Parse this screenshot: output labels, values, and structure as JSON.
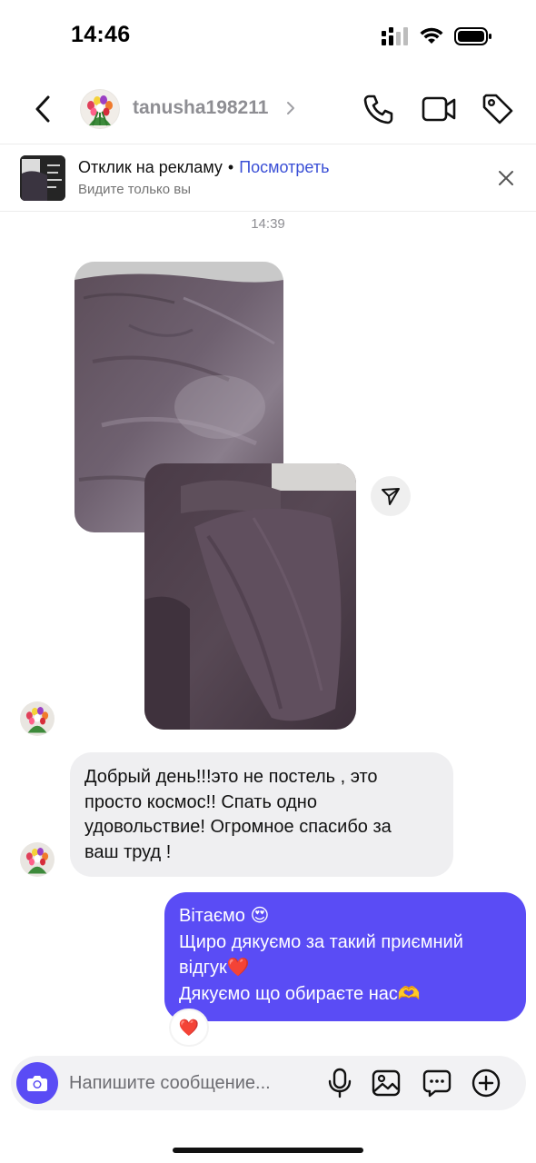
{
  "status_bar": {
    "time": "14:46",
    "signal_icon": "cellular-signal-icon",
    "wifi_icon": "wifi-icon",
    "battery_icon": "battery-icon"
  },
  "header": {
    "username": "tanusha198211",
    "back_icon": "chevron-left-icon",
    "call_icon": "phone-icon",
    "video_icon": "video-camera-icon",
    "tag_icon": "tag-icon"
  },
  "ad_banner": {
    "title": "Отклик на рекламу",
    "separator": "•",
    "link": "Посмотреть",
    "subtitle": "Видите только вы",
    "close_icon": "close-icon"
  },
  "conversation": {
    "timestamp": "14:39",
    "incoming_text_lines": [
      "Добрый день!!!это не постель , это",
      "просто космос!! Спать одно",
      "удовольствие! Огромное спасибо за",
      "ваш труд !"
    ],
    "outgoing_text_lines": [
      "Вітаємо 😍",
      "Щиро дякуємо за такий приємний",
      "відгук❤️",
      "Дякуємо що обираєте нас🫶"
    ],
    "reaction": "❤️",
    "share_icon": "send-icon"
  },
  "composer": {
    "placeholder": "Напишите сообщение...",
    "camera_icon": "camera-icon",
    "mic_icon": "microphone-icon",
    "gallery_icon": "image-icon",
    "sticker_icon": "chat-bubble-icon",
    "add_icon": "plus-circle-icon"
  },
  "colors": {
    "accent": "#5a4cf5",
    "link": "#3a4fd6",
    "incoming_bubble": "#efeff1"
  }
}
